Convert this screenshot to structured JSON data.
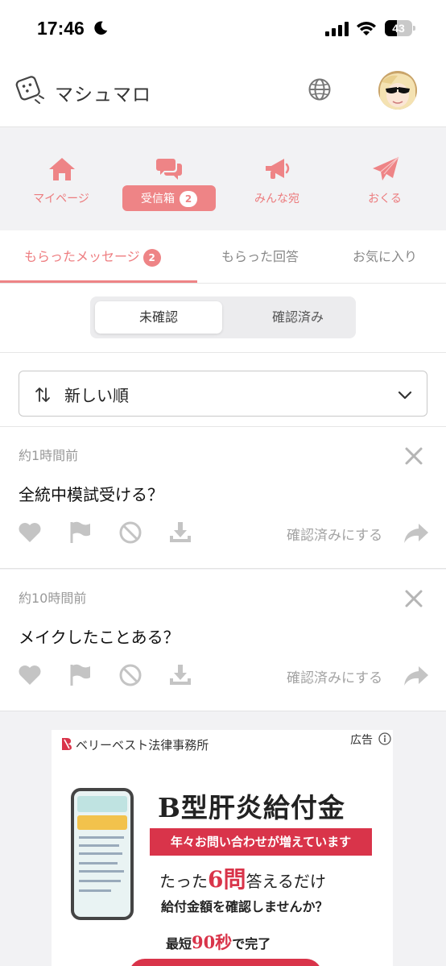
{
  "status": {
    "time": "17:46",
    "battery": "43",
    "battery_level": 0.43
  },
  "header": {
    "app_name": "マシュマロ"
  },
  "nav": {
    "items": [
      {
        "label": "マイページ"
      },
      {
        "label": "受信箱",
        "badge": "2"
      },
      {
        "label": "みんな宛"
      },
      {
        "label": "おくる"
      }
    ]
  },
  "tabs": [
    {
      "label": "もらったメッセージ",
      "badge": "2"
    },
    {
      "label": "もらった回答"
    },
    {
      "label": "お気に入り"
    }
  ],
  "segment": {
    "unconfirmed": "未確認",
    "confirmed": "確認済み"
  },
  "sort": {
    "label": "新しい順"
  },
  "messages": [
    {
      "time": "約1時間前",
      "text": "全統中模試受ける？",
      "confirm": "確認済みにする"
    },
    {
      "time": "約10時間前",
      "text": "メイクしたことある？",
      "confirm": "確認済みにする"
    }
  ],
  "ad": {
    "brand": "ベリーベスト法律事務所",
    "label": "広告",
    "headline": "B型肝炎給付金",
    "banner": "年々お問い合わせが増えています",
    "line3_pre": "たった",
    "line3_num": "6問",
    "line3_post": "答えるだけ",
    "line4": "給付金額を確認しませんか？",
    "line5_pre": "最短",
    "line5_num": "90秒",
    "line5_post": "で完了"
  },
  "colors": {
    "accent": "#ee8486",
    "accent_text": "#ec7c7e",
    "ad_red": "#d9344a"
  }
}
